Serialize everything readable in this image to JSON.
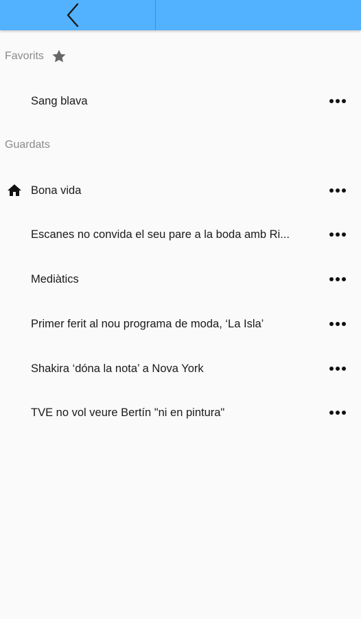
{
  "favorites": {
    "title": "Favorits",
    "items": [
      {
        "label": "Sang blava"
      }
    ]
  },
  "saved": {
    "title": "Guardats",
    "items": [
      {
        "label": "Bona vida",
        "icon": "home-icon"
      },
      {
        "label": "Escanes no convida el seu pare a la boda amb Ri..."
      },
      {
        "label": "Mediàtics"
      },
      {
        "label": "Primer ferit al nou programa de moda, ‘La Isla’"
      },
      {
        "label": "Shakira ‘dóna la nota’ a Nova York"
      },
      {
        "label": "TVE no vol veure Bertín \"ni en pintura\""
      }
    ]
  },
  "colors": {
    "topbar": "#52b2ff",
    "background": "#fafafa",
    "section_header": "#8a8a8a",
    "text": "#1a1a1a"
  }
}
